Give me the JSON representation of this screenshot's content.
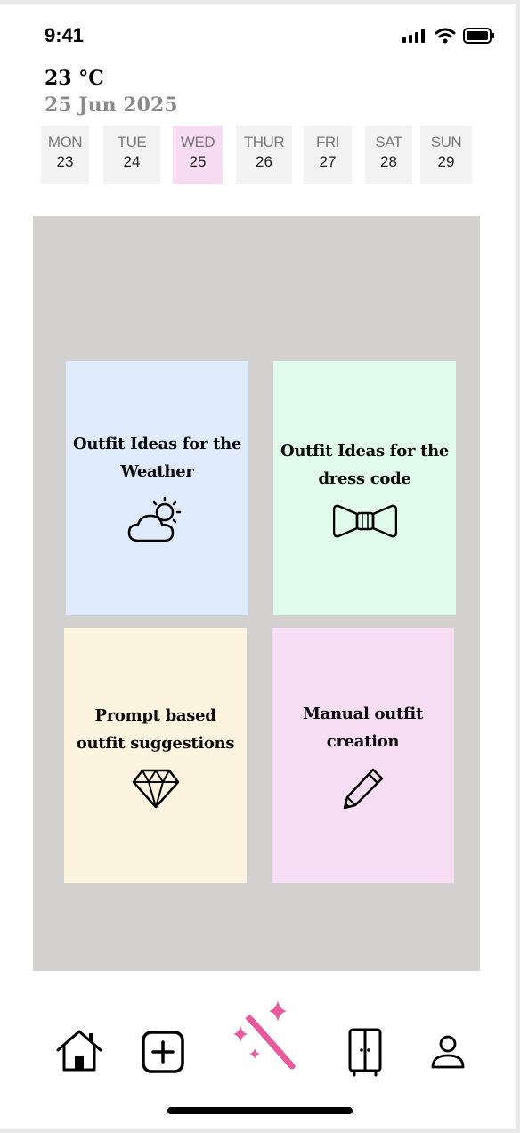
{
  "status": {
    "time": "9:41"
  },
  "weather": {
    "temperature": "23 °C",
    "date": "25 Jun 2025"
  },
  "days": [
    {
      "name": "MON",
      "num": "23",
      "active": false
    },
    {
      "name": "TUE",
      "num": "24",
      "active": false
    },
    {
      "name": "WED",
      "num": "25",
      "active": true
    },
    {
      "name": "THUR",
      "num": "26",
      "active": false
    },
    {
      "name": "FRI",
      "num": "27",
      "active": false
    },
    {
      "name": "SAT",
      "num": "28",
      "active": false
    },
    {
      "name": "SUN",
      "num": "29",
      "active": false
    }
  ],
  "cards": {
    "weather": {
      "title": "Outfit Ideas for the Weather",
      "icon": "sun-cloud-icon",
      "color": "#dfebfb"
    },
    "dresscode": {
      "title": "Outfit Ideas for the dress code",
      "icon": "bow-tie-icon",
      "color": "#e1fbea"
    },
    "prompt": {
      "title": "Prompt based outfit suggestions",
      "icon": "diamond-icon",
      "color": "#fdf4e0"
    },
    "manual": {
      "title": "Manual outfit creation",
      "icon": "pencil-icon",
      "color": "#f8def4"
    }
  },
  "nav": {
    "items": [
      "home-icon",
      "add-icon",
      "magic-wand-icon",
      "wardrobe-icon",
      "profile-icon"
    ],
    "accent": "#e85a9e"
  }
}
